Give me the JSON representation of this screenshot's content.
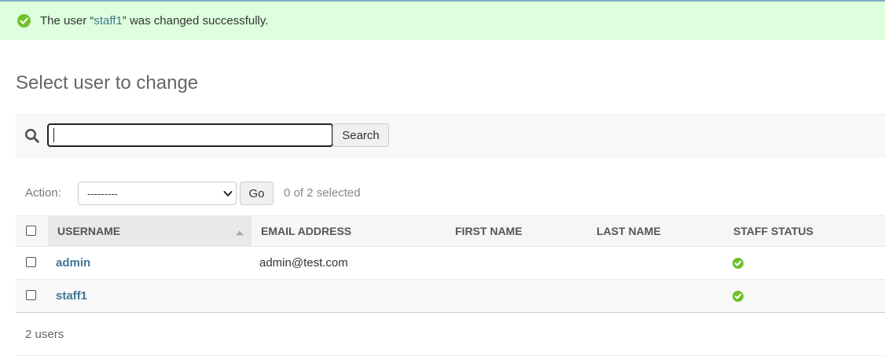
{
  "message": {
    "prefix": "The user “",
    "user_link": "staff1",
    "suffix": "” was changed successfully."
  },
  "page_title": "Select user to change",
  "search": {
    "value": "",
    "button_label": "Search"
  },
  "actions": {
    "label": "Action:",
    "selected_option": "---------",
    "go_label": "Go",
    "selection_counter": "0 of 2 selected"
  },
  "table": {
    "columns": [
      "Username",
      "Email address",
      "First name",
      "Last name",
      "Staff status"
    ],
    "sorted_column": "Username",
    "sort_direction": "ascending",
    "rows": [
      {
        "username": "admin",
        "email": "admin@test.com",
        "first_name": "",
        "last_name": "",
        "staff_status": true
      },
      {
        "username": "staff1",
        "email": "",
        "first_name": "",
        "last_name": "",
        "staff_status": true
      }
    ]
  },
  "paginator": {
    "text": "2 users"
  },
  "colors": {
    "success_bg": "#dfd",
    "success_icon": "#70bf2b",
    "link": "#417690",
    "top_border": "#79aec8"
  },
  "icons": {
    "message": "success-check-icon",
    "search": "search-icon",
    "sort": "sort-ascending-icon",
    "staff_status": "yes-check-icon"
  }
}
